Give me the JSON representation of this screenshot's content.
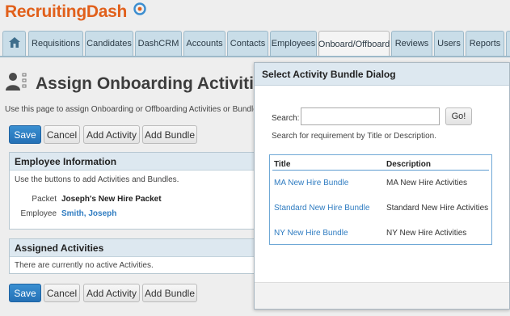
{
  "app": {
    "logo_text_a": "Recruiting",
    "logo_text_b": "Dash"
  },
  "nav": {
    "tabs": [
      {
        "label": "Requisitions"
      },
      {
        "label": "Candidates"
      },
      {
        "label": "DashCRM"
      },
      {
        "label": "Accounts"
      },
      {
        "label": "Contacts"
      },
      {
        "label": "Employees"
      },
      {
        "label": "Onboard/Offboard"
      },
      {
        "label": "Reviews"
      },
      {
        "label": "Users"
      },
      {
        "label": "Reports"
      }
    ],
    "active": "Onboard/Offboard"
  },
  "page": {
    "title": "Assign Onboarding Activities",
    "intro": "Use this page to assign Onboarding or Offboarding Activities or Bundles to"
  },
  "toolbar": {
    "save_label": "Save",
    "cancel_label": "Cancel",
    "add_activity_label": "Add Activity",
    "add_bundle_label": "Add Bundle"
  },
  "employee_info": {
    "heading": "Employee Information",
    "instructions": "Use the buttons to add Activities and Bundles.",
    "packet_label": "Packet",
    "packet_value": "Joseph's New Hire Packet",
    "employee_label": "Employee",
    "employee_value": "Smith, Joseph"
  },
  "assigned": {
    "heading": "Assigned Activities",
    "empty_text": "There are currently no active Activities."
  },
  "dialog": {
    "title": "Select Activity Bundle Dialog",
    "search_label": "Search:",
    "search_value": "",
    "go_label": "Go!",
    "hint": "Search for requirement by Title or Description.",
    "columns": {
      "title": "Title",
      "description": "Description"
    },
    "rows": [
      {
        "title": "MA New Hire Bundle",
        "description": "MA New Hire Activities"
      },
      {
        "title": "Standard New Hire Bundle",
        "description": "Standard New Hire Activities"
      },
      {
        "title": "NY New Hire Bundle",
        "description": "NY New Hire Activities"
      }
    ]
  },
  "colors": {
    "brand": "#e1601b",
    "link": "#2f7cc1",
    "primary_button": "#2571b6"
  },
  "icons": {
    "home": "home-icon",
    "title": "user-checklist-icon",
    "logo": "dash-logo-icon"
  }
}
